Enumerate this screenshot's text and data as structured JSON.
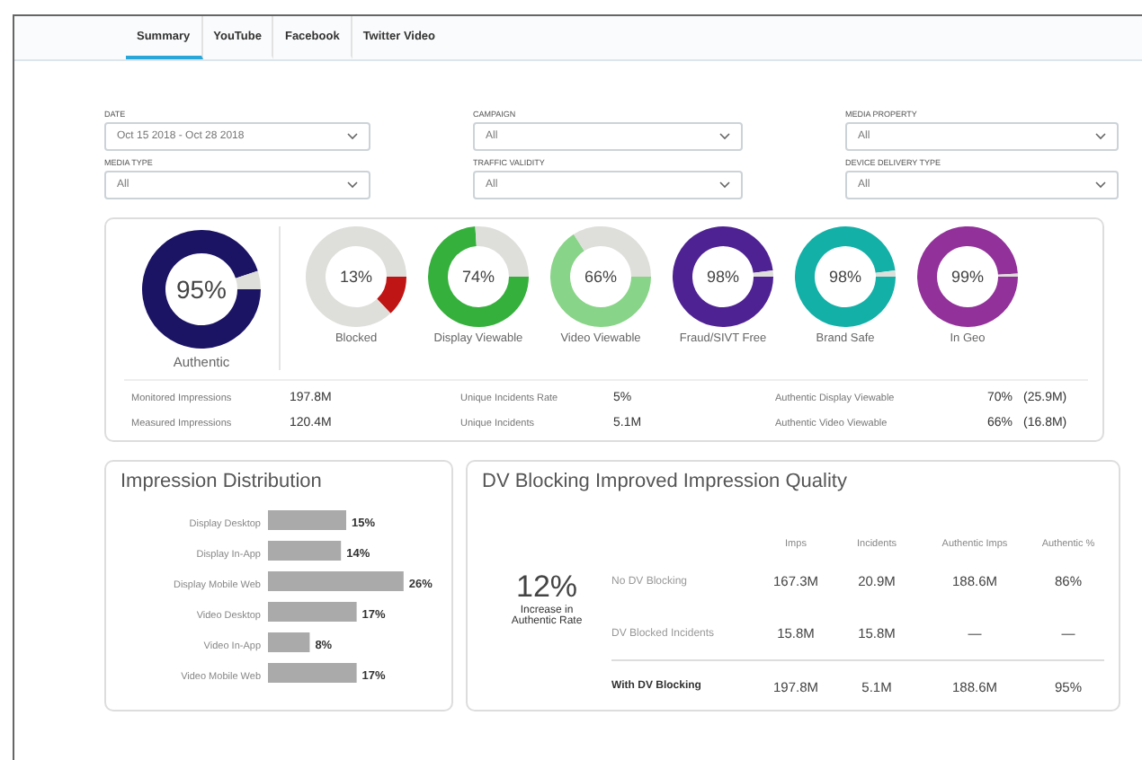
{
  "tabs": [
    {
      "label": "Summary",
      "selected": true
    },
    {
      "label": "YouTube",
      "selected": false
    },
    {
      "label": "Facebook",
      "selected": false
    },
    {
      "label": "Twitter Video",
      "selected": false
    }
  ],
  "filters": [
    {
      "label": "DATE",
      "value": "Oct 15 2018 - Oct 28 2018"
    },
    {
      "label": "CAMPAIGN",
      "value": "All"
    },
    {
      "label": "MEDIA PROPERTY",
      "value": "All"
    },
    {
      "label": "MEDIA TYPE",
      "value": "All"
    },
    {
      "label": "TRAFFIC VALIDITY",
      "value": "All"
    },
    {
      "label": "DEVICE DELIVERY TYPE",
      "value": "All"
    }
  ],
  "donuts": [
    {
      "label": "Authentic",
      "value": "95%",
      "chart_data": {
        "type": "donut",
        "values": [
          95,
          5
        ],
        "colors": [
          "#1b1464",
          "#dededa"
        ]
      }
    },
    {
      "label": "Blocked",
      "value": "13%",
      "chart_data": {
        "type": "donut",
        "values": [
          13,
          87
        ],
        "colors": [
          "#c01515",
          "#dededa"
        ]
      }
    },
    {
      "label": "Display Viewable",
      "value": "74%",
      "chart_data": {
        "type": "donut",
        "values": [
          74,
          26
        ],
        "colors": [
          "#36b03c",
          "#dededa"
        ]
      }
    },
    {
      "label": "Video Viewable",
      "value": "66%",
      "chart_data": {
        "type": "donut",
        "values": [
          66,
          34
        ],
        "colors": [
          "#88d488",
          "#dededa"
        ]
      }
    },
    {
      "label": "Fraud/SIVT Free",
      "value": "98%",
      "chart_data": {
        "type": "donut",
        "values": [
          98,
          2
        ],
        "colors": [
          "#4f2293",
          "#dededa"
        ]
      }
    },
    {
      "label": "Brand Safe",
      "value": "98%",
      "chart_data": {
        "type": "donut",
        "values": [
          98,
          2
        ],
        "colors": [
          "#13b0a8",
          "#dededa"
        ]
      }
    },
    {
      "label": "In Geo",
      "value": "99%",
      "chart_data": {
        "type": "donut",
        "values": [
          99,
          1
        ],
        "colors": [
          "#92319a",
          "#dededa"
        ]
      }
    }
  ],
  "metrics": [
    {
      "label": "Monitored Impressions",
      "value": "197.8M"
    },
    {
      "label": "Unique Incidents Rate",
      "value": "5%"
    },
    {
      "label": "Authentic Display Viewable",
      "value": "70%",
      "extra": "(25.9M)"
    },
    {
      "label": "Measured Impressions",
      "value": "120.4M"
    },
    {
      "label": "Unique Incidents",
      "value": "5.1M"
    },
    {
      "label": "Authentic Video Viewable",
      "value": "66%",
      "extra": "(16.8M)"
    }
  ],
  "impression_distribution": {
    "title": "Impression Distribution",
    "chart_data": {
      "type": "bar",
      "orientation": "horizontal",
      "categories": [
        "Display Desktop",
        "Display In-App",
        "Display Mobile Web",
        "Video Desktop",
        "Video In-App",
        "Video Mobile Web"
      ],
      "series": [
        {
          "color": "#aaaaaa",
          "values": [
            15,
            14,
            26,
            17,
            8,
            17
          ],
          "value_labels": [
            "15%",
            "14%",
            "26%",
            "17%",
            "8%",
            "17%"
          ]
        }
      ],
      "data_labels": true
    }
  },
  "dv_blocking": {
    "title": "DV Blocking Improved Impression Quality",
    "headline": "12%",
    "headline_caption": "Increase in Authentic Rate",
    "columns": [
      "Imps",
      "Incidents",
      "Authentic Imps",
      "Authentic %"
    ],
    "rows": [
      {
        "label": "No DV Blocking",
        "cells": [
          "167.3M",
          "20.9M",
          "188.6M",
          "86%"
        ],
        "bold": false
      },
      {
        "label": "DV Blocked Incidents",
        "cells": [
          "15.8M",
          "15.8M",
          "—",
          "—"
        ],
        "bold": false
      },
      {
        "label": "With DV Blocking",
        "cells": [
          "197.8M",
          "5.1M",
          "188.6M",
          "95%"
        ],
        "bold": true
      }
    ]
  }
}
